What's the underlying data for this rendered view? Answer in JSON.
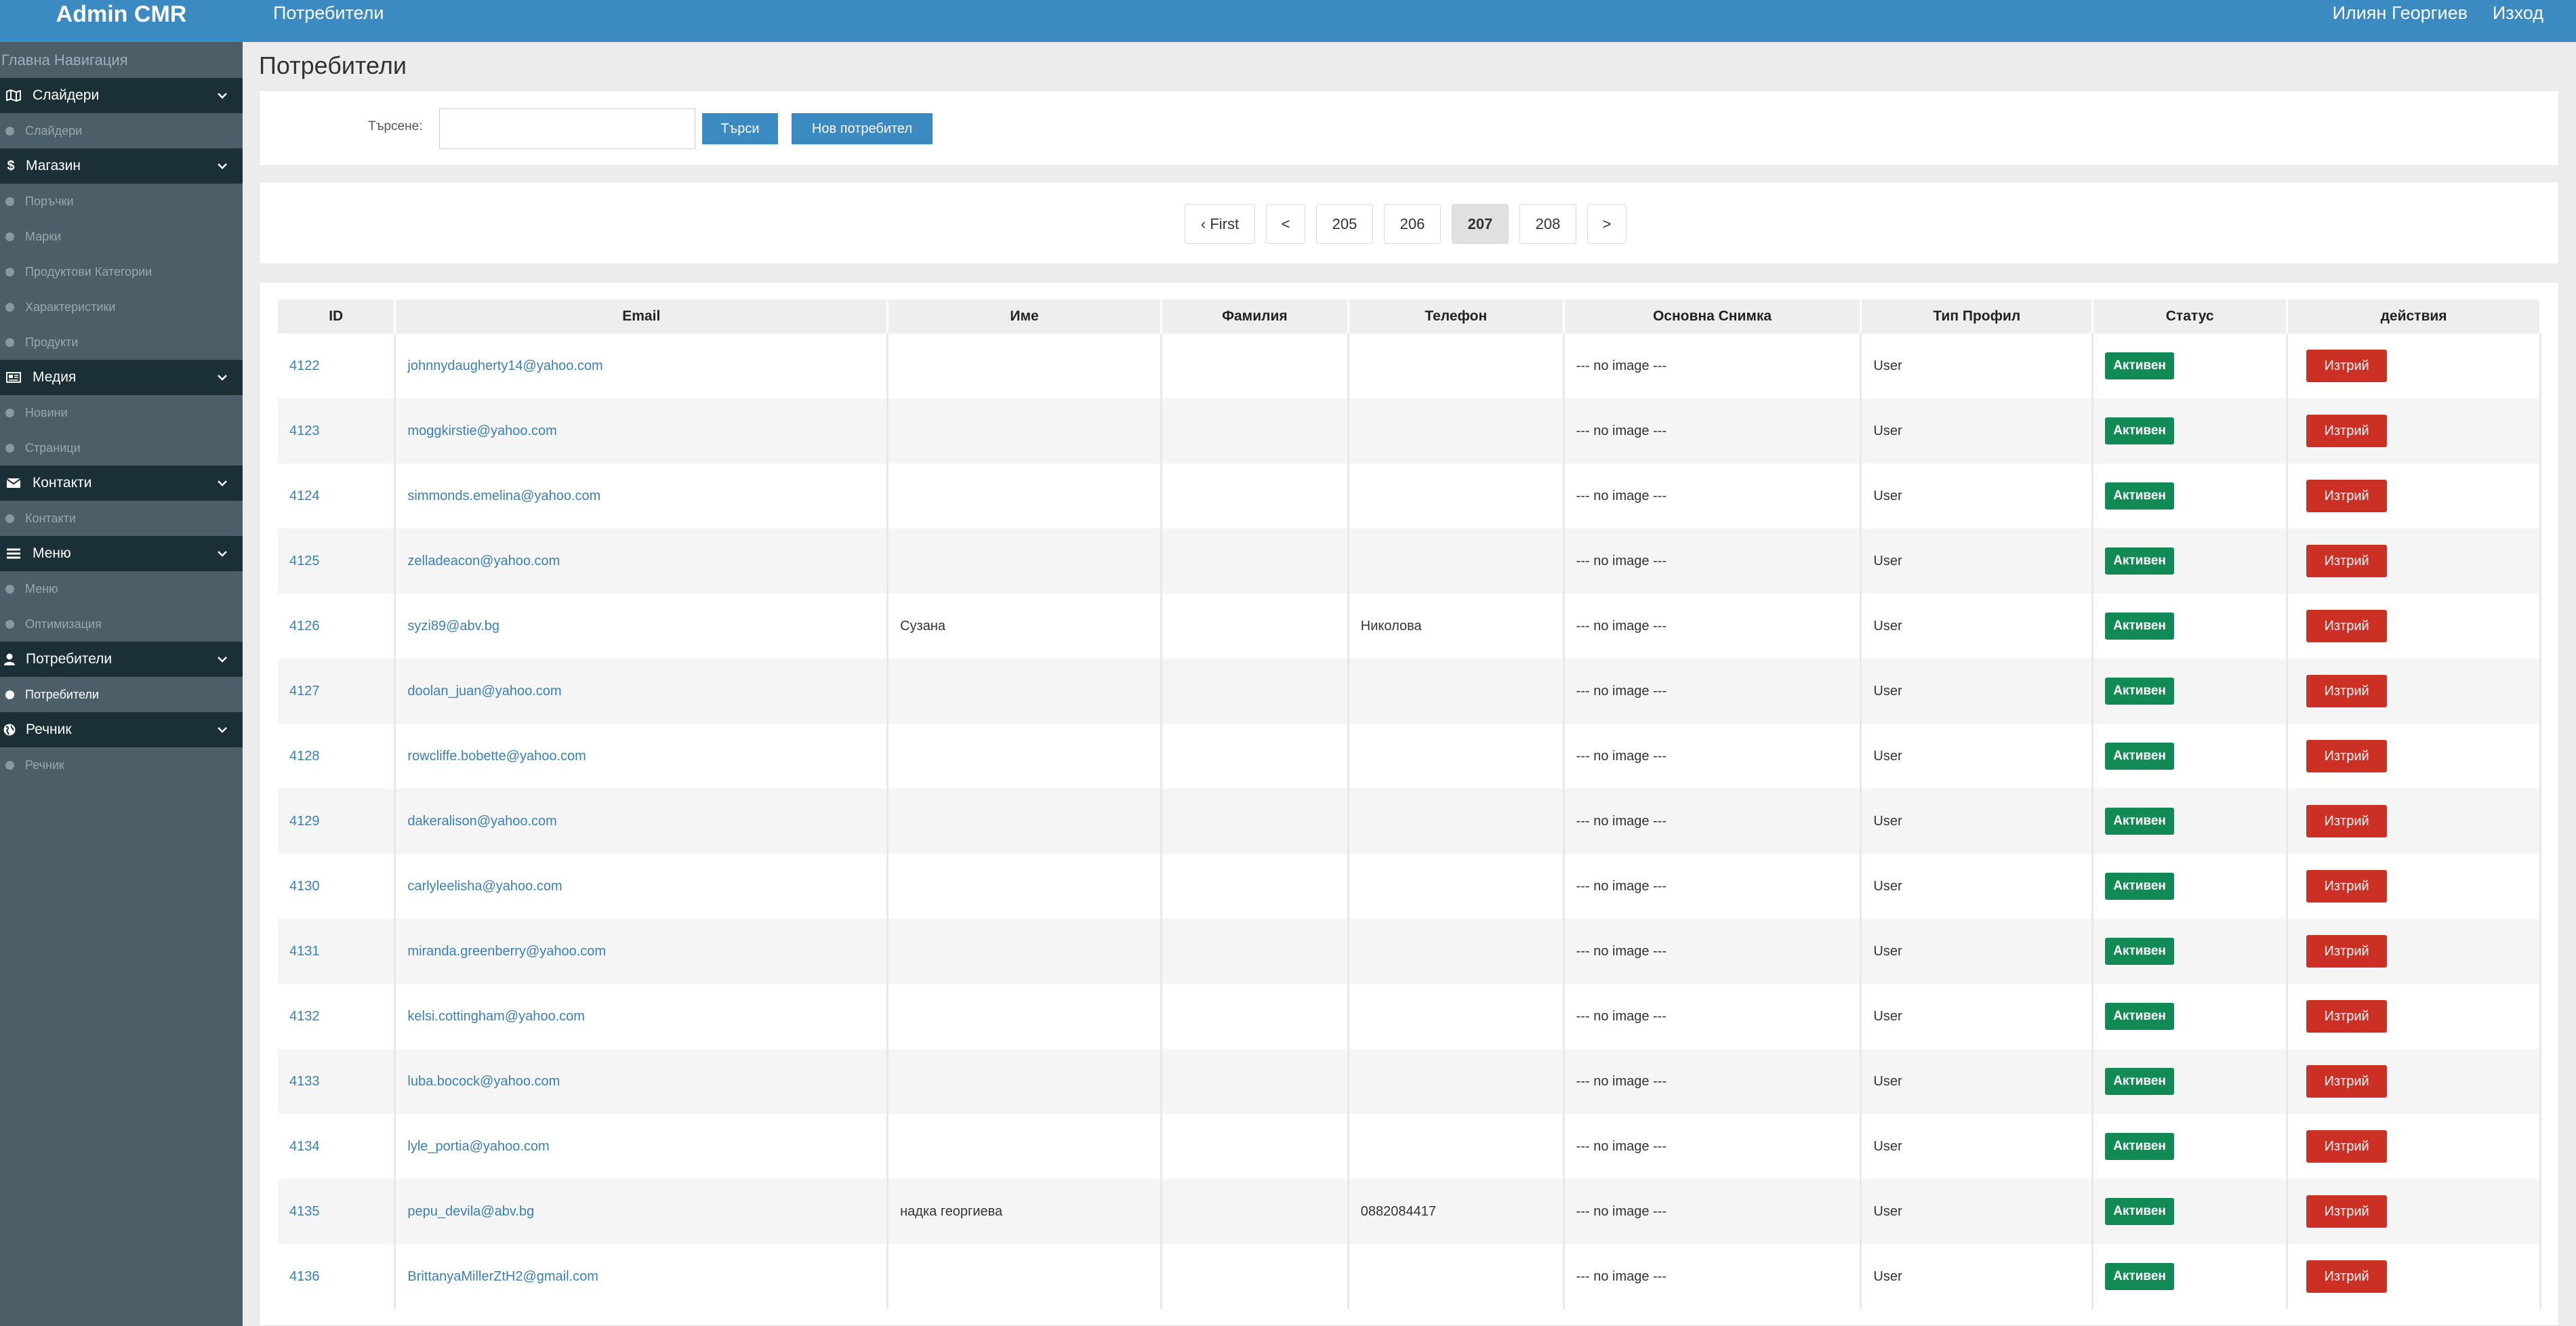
{
  "app": {
    "brand": "Admin CMR"
  },
  "topbar": {
    "crumb": "Потребители",
    "user": "Илиян Георгиев",
    "logout": "Изход"
  },
  "sidebar": {
    "heading": "Главна Навигация",
    "sections": [
      {
        "label": "Слайдери",
        "icon": "map-icon",
        "items": [
          {
            "label": "Слайдери"
          }
        ]
      },
      {
        "label": "Магазин",
        "icon": "dollar-icon",
        "items": [
          {
            "label": "Поръчки"
          },
          {
            "label": "Марки"
          },
          {
            "label": "Продуктови Категории"
          },
          {
            "label": "Характеристики"
          },
          {
            "label": "Продукти"
          }
        ]
      },
      {
        "label": "Медия",
        "icon": "newspaper-icon",
        "items": [
          {
            "label": "Новини"
          },
          {
            "label": "Страници"
          }
        ]
      },
      {
        "label": "Контакти",
        "icon": "envelope-icon",
        "items": [
          {
            "label": "Контакти"
          }
        ]
      },
      {
        "label": "Меню",
        "icon": "bars-icon",
        "items": [
          {
            "label": "Меню"
          },
          {
            "label": "Оптимизация"
          }
        ]
      },
      {
        "label": "Потребители",
        "icon": "user-icon",
        "items": [
          {
            "label": "Потребители",
            "active": true
          }
        ]
      },
      {
        "label": "Речник",
        "icon": "globe-icon",
        "items": [
          {
            "label": "Речник"
          }
        ]
      }
    ]
  },
  "page": {
    "title": "Потребители"
  },
  "search": {
    "label": "Търсене:",
    "value": "",
    "button": "Търси",
    "new_user": "Нов потребител"
  },
  "pagination": [
    {
      "label": "‹ First"
    },
    {
      "label": "<"
    },
    {
      "label": "205"
    },
    {
      "label": "206"
    },
    {
      "label": "207",
      "current": true
    },
    {
      "label": "208"
    },
    {
      "label": ">"
    }
  ],
  "table": {
    "columns": [
      "ID",
      "Email",
      "Име",
      "Фамилия",
      "Телефон",
      "Основна Снимка",
      "Тип Профил",
      "Статус",
      "действия"
    ],
    "rows": [
      {
        "id": "4122",
        "email": "johnnydaugherty14@yahoo.com",
        "first_name": "",
        "last_name": "",
        "phone": "",
        "image": "--- no image ---",
        "profile_type": "User",
        "status": "Активен",
        "action": "Изтрий"
      },
      {
        "id": "4123",
        "email": "moggkirstie@yahoo.com",
        "first_name": "",
        "last_name": "",
        "phone": "",
        "image": "--- no image ---",
        "profile_type": "User",
        "status": "Активен",
        "action": "Изтрий"
      },
      {
        "id": "4124",
        "email": "simmonds.emelina@yahoo.com",
        "first_name": "",
        "last_name": "",
        "phone": "",
        "image": "--- no image ---",
        "profile_type": "User",
        "status": "Активен",
        "action": "Изтрий"
      },
      {
        "id": "4125",
        "email": "zelladeacon@yahoo.com",
        "first_name": "",
        "last_name": "",
        "phone": "",
        "image": "--- no image ---",
        "profile_type": "User",
        "status": "Активен",
        "action": "Изтрий"
      },
      {
        "id": "4126",
        "email": "syzi89@abv.bg",
        "first_name": "Сузана",
        "last_name": "",
        "phone": "Николова",
        "image": "--- no image ---",
        "profile_type": "User",
        "status": "Активен",
        "action": "Изтрий"
      },
      {
        "id": "4127",
        "email": "doolan_juan@yahoo.com",
        "first_name": "",
        "last_name": "",
        "phone": "",
        "image": "--- no image ---",
        "profile_type": "User",
        "status": "Активен",
        "action": "Изтрий"
      },
      {
        "id": "4128",
        "email": "rowcliffe.bobette@yahoo.com",
        "first_name": "",
        "last_name": "",
        "phone": "",
        "image": "--- no image ---",
        "profile_type": "User",
        "status": "Активен",
        "action": "Изтрий"
      },
      {
        "id": "4129",
        "email": "dakeralison@yahoo.com",
        "first_name": "",
        "last_name": "",
        "phone": "",
        "image": "--- no image ---",
        "profile_type": "User",
        "status": "Активен",
        "action": "Изтрий"
      },
      {
        "id": "4130",
        "email": "carlyleelisha@yahoo.com",
        "first_name": "",
        "last_name": "",
        "phone": "",
        "image": "--- no image ---",
        "profile_type": "User",
        "status": "Активен",
        "action": "Изтрий"
      },
      {
        "id": "4131",
        "email": "miranda.greenberry@yahoo.com",
        "first_name": "",
        "last_name": "",
        "phone": "",
        "image": "--- no image ---",
        "profile_type": "User",
        "status": "Активен",
        "action": "Изтрий"
      },
      {
        "id": "4132",
        "email": "kelsi.cottingham@yahoo.com",
        "first_name": "",
        "last_name": "",
        "phone": "",
        "image": "--- no image ---",
        "profile_type": "User",
        "status": "Активен",
        "action": "Изтрий"
      },
      {
        "id": "4133",
        "email": "luba.bocock@yahoo.com",
        "first_name": "",
        "last_name": "",
        "phone": "",
        "image": "--- no image ---",
        "profile_type": "User",
        "status": "Активен",
        "action": "Изтрий"
      },
      {
        "id": "4134",
        "email": "lyle_portia@yahoo.com",
        "first_name": "",
        "last_name": "",
        "phone": "",
        "image": "--- no image ---",
        "profile_type": "User",
        "status": "Активен",
        "action": "Изтрий"
      },
      {
        "id": "4135",
        "email": "pepu_devila@abv.bg",
        "first_name": "надка георгиева",
        "last_name": "",
        "phone": "0882084417",
        "image": "--- no image ---",
        "profile_type": "User",
        "status": "Активен",
        "action": "Изтрий"
      },
      {
        "id": "4136",
        "email": "BrittanyaMillerZtH2@gmail.com",
        "first_name": "",
        "last_name": "",
        "phone": "",
        "image": "--- no image ---",
        "profile_type": "User",
        "status": "Активен",
        "action": "Изтрий"
      }
    ]
  },
  "colors": {
    "brand_blue": "#3b8ac2",
    "sidebar_dark": "#1b2f36",
    "sidebar_bg": "#4c5e68",
    "status_green": "#128a55",
    "danger_red": "#cc3024",
    "link_blue": "#3b7fb5"
  }
}
